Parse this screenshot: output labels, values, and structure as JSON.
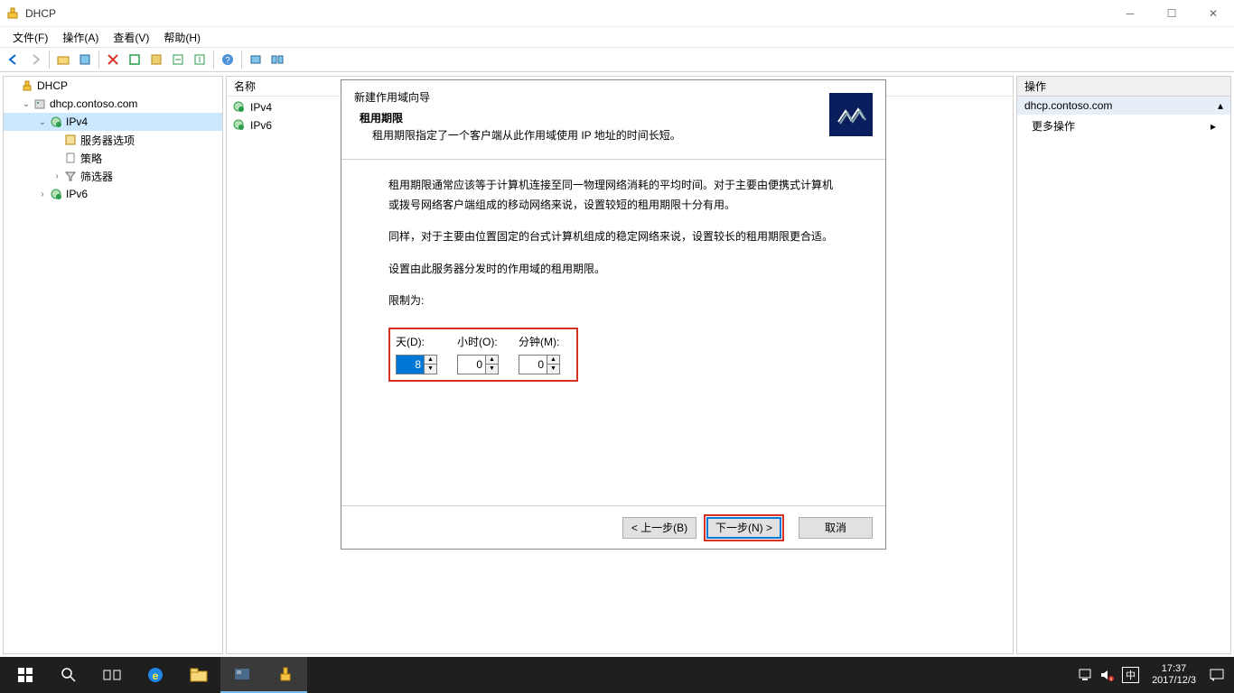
{
  "window": {
    "title": "DHCP"
  },
  "menu": {
    "file": "文件(F)",
    "action": "操作(A)",
    "view": "查看(V)",
    "help": "帮助(H)"
  },
  "tree": {
    "root": "DHCP",
    "server": "dhcp.contoso.com",
    "ipv4": "IPv4",
    "server_options": "服务器选项",
    "policy": "策略",
    "filter": "筛选器",
    "ipv6": "IPv6"
  },
  "content": {
    "col_name": "名称",
    "row1": "IPv4",
    "row2": "IPv6"
  },
  "actions": {
    "header": "操作",
    "server": "dhcp.contoso.com",
    "more": "更多操作"
  },
  "wizard": {
    "window_title": "新建作用域向导",
    "section_title": "租用期限",
    "section_desc": "租用期限指定了一个客户端从此作用域使用 IP 地址的时间长短。",
    "para1": "租用期限通常应该等于计算机连接至同一物理网络消耗的平均时间。对于主要由便携式计算机或拨号网络客户端组成的移动网络来说，设置较短的租用期限十分有用。",
    "para2": "同样，对于主要由位置固定的台式计算机组成的稳定网络来说，设置较长的租用期限更合适。",
    "para3": "设置由此服务器分发时的作用域的租用期限。",
    "limit_label": "限制为:",
    "days_label": "天(D):",
    "hours_label": "小时(O):",
    "minutes_label": "分钟(M):",
    "days_value": "8",
    "hours_value": "0",
    "minutes_value": "0",
    "btn_back": "< 上一步(B)",
    "btn_next": "下一步(N) >",
    "btn_cancel": "取消"
  },
  "taskbar": {
    "time": "17:37",
    "date": "2017/12/3",
    "ime": "中"
  }
}
